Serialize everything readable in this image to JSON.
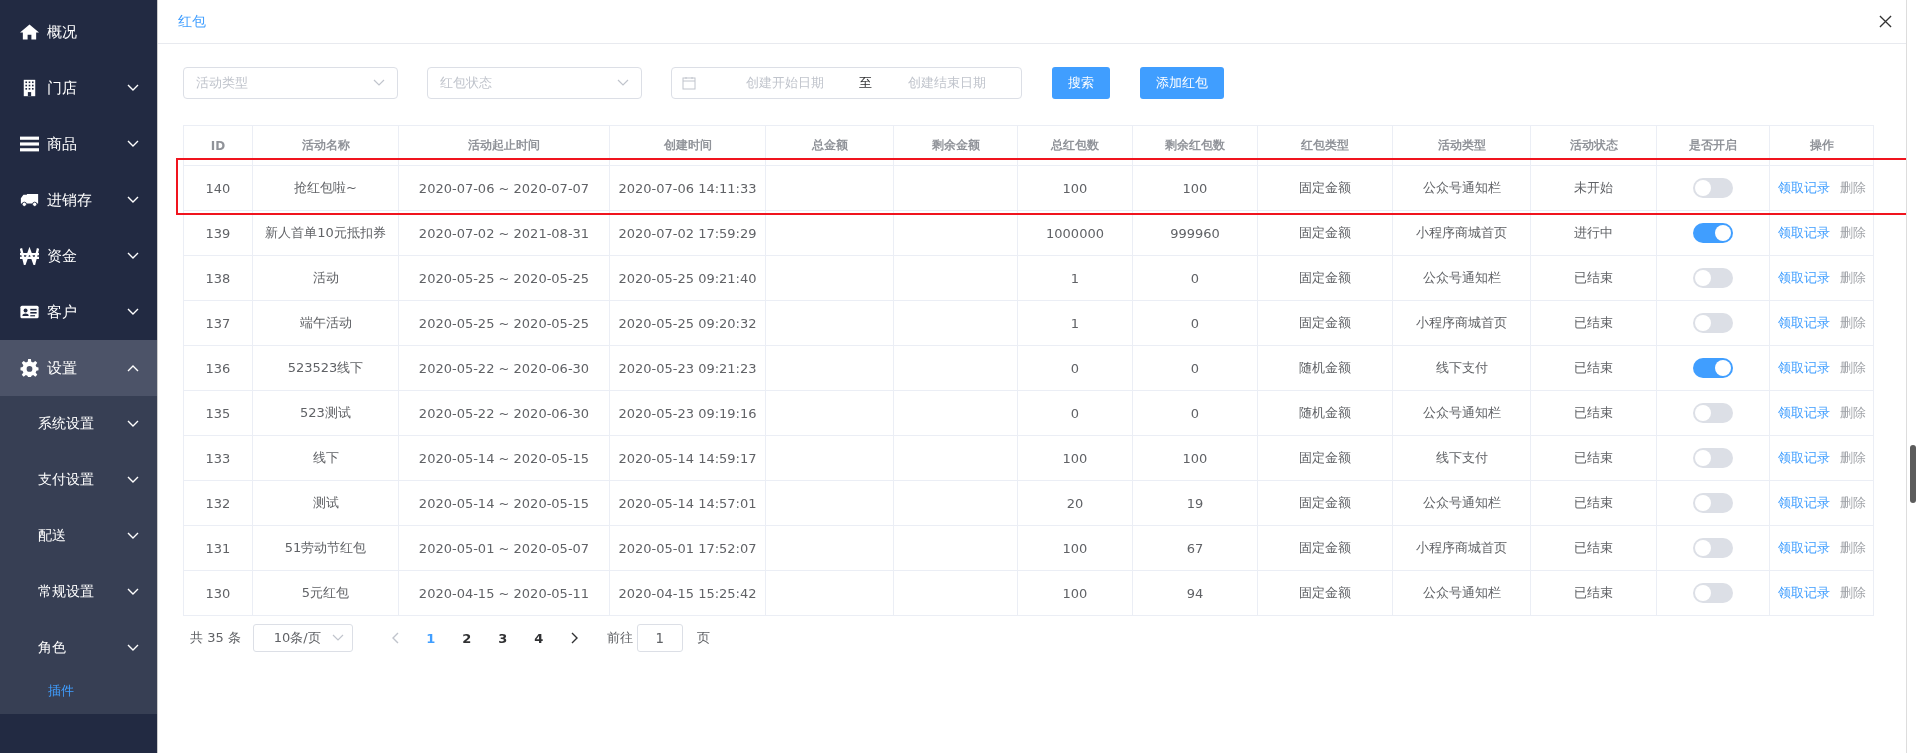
{
  "sidebar": {
    "items": [
      {
        "label": "概况",
        "kind": "link",
        "expanded": false
      },
      {
        "label": "门店",
        "kind": "group",
        "expanded": false
      },
      {
        "label": "商品",
        "kind": "group",
        "expanded": false
      },
      {
        "label": "进销存",
        "kind": "group",
        "expanded": false
      },
      {
        "label": "资金",
        "kind": "group",
        "expanded": false
      },
      {
        "label": "客户",
        "kind": "group",
        "expanded": false
      },
      {
        "label": "设置",
        "kind": "group",
        "expanded": true,
        "children": [
          {
            "label": "系统设置",
            "kind": "group",
            "expanded": false,
            "selected": false
          },
          {
            "label": "支付设置",
            "kind": "group",
            "expanded": false,
            "selected": false
          },
          {
            "label": "配送",
            "kind": "group",
            "expanded": false,
            "selected": false
          },
          {
            "label": "常规设置",
            "kind": "group",
            "expanded": false,
            "selected": false
          },
          {
            "label": "角色",
            "kind": "group",
            "expanded": false,
            "selected": false
          },
          {
            "label": "插件",
            "kind": "link",
            "selected": true
          }
        ]
      }
    ]
  },
  "dialog": {
    "title": "红包",
    "filters": {
      "activity_type": {
        "placeholder": "活动类型"
      },
      "status": {
        "placeholder": "红包状态"
      },
      "start_date": {
        "placeholder": "创建开始日期"
      },
      "separator": "至",
      "end_date": {
        "placeholder": "创建结束日期"
      },
      "buttons": [
        "搜索",
        "添加红包"
      ]
    },
    "table": {
      "columns": [
        "ID",
        "活动名称",
        "活动起止时间",
        "创建时间",
        "总金额",
        "剩余金额",
        "总红包数",
        "剩余红包数",
        "红包类型",
        "活动类型",
        "活动状态",
        "是否开启",
        "操作"
      ],
      "rows": [
        {
          "cells": [
            "140",
            "抢红包啦~",
            "2020-07-06 ~ 2020-07-07",
            "2020-07-06 14:11:33",
            "",
            "",
            "100",
            "100",
            "固定金额",
            "公众号通知栏",
            "未开始"
          ],
          "on": false,
          "actions": [
            "领取记录",
            "删除"
          ]
        },
        {
          "cells": [
            "139",
            "新人首单10元抵扣券",
            "2020-07-02 ~ 2021-08-31",
            "2020-07-02 17:59:29",
            "",
            "",
            "1000000",
            "999960",
            "固定金额",
            "小程序商城首页",
            "进行中"
          ],
          "on": true,
          "actions": [
            "领取记录",
            "删除"
          ]
        },
        {
          "cells": [
            "138",
            "活动",
            "2020-05-25 ~ 2020-05-25",
            "2020-05-25 09:21:40",
            "",
            "",
            "1",
            "0",
            "固定金额",
            "公众号通知栏",
            "已结束"
          ],
          "on": false,
          "actions": [
            "领取记录",
            "删除"
          ]
        },
        {
          "cells": [
            "137",
            "端午活动",
            "2020-05-25 ~ 2020-05-25",
            "2020-05-25 09:20:32",
            "",
            "",
            "1",
            "0",
            "固定金额",
            "小程序商城首页",
            "已结束"
          ],
          "on": false,
          "actions": [
            "领取记录",
            "删除"
          ]
        },
        {
          "cells": [
            "136",
            "523523线下",
            "2020-05-22 ~ 2020-06-30",
            "2020-05-23 09:21:23",
            "",
            "",
            "0",
            "0",
            "随机金额",
            "线下支付",
            "已结束"
          ],
          "on": true,
          "actions": [
            "领取记录",
            "删除"
          ]
        },
        {
          "cells": [
            "135",
            "523测试",
            "2020-05-22 ~ 2020-06-30",
            "2020-05-23 09:19:16",
            "",
            "",
            "0",
            "0",
            "随机金额",
            "公众号通知栏",
            "已结束"
          ],
          "on": false,
          "actions": [
            "领取记录",
            "删除"
          ]
        },
        {
          "cells": [
            "133",
            "线下",
            "2020-05-14 ~ 2020-05-15",
            "2020-05-14 14:59:17",
            "",
            "",
            "100",
            "100",
            "固定金额",
            "线下支付",
            "已结束"
          ],
          "on": false,
          "actions": [
            "领取记录",
            "删除"
          ]
        },
        {
          "cells": [
            "132",
            "测试",
            "2020-05-14 ~ 2020-05-15",
            "2020-05-14 14:57:01",
            "",
            "",
            "20",
            "19",
            "固定金额",
            "公众号通知栏",
            "已结束"
          ],
          "on": false,
          "actions": [
            "领取记录",
            "删除"
          ]
        },
        {
          "cells": [
            "131",
            "51劳动节红包",
            "2020-05-01 ~ 2020-05-07",
            "2020-05-01 17:52:07",
            "",
            "",
            "100",
            "67",
            "固定金额",
            "小程序商城首页",
            "已结束"
          ],
          "on": false,
          "actions": [
            "领取记录",
            "删除"
          ]
        },
        {
          "cells": [
            "130",
            "5元红包",
            "2020-04-15 ~ 2020-05-11",
            "2020-04-15 15:25:42",
            "",
            "",
            "100",
            "94",
            "固定金额",
            "公众号通知栏",
            "已结束"
          ],
          "on": false,
          "actions": [
            "领取记录",
            "删除"
          ]
        }
      ]
    },
    "pagination": {
      "total": "共 35 条",
      "page_size": "10条/页",
      "pages": [
        {
          "label": "1",
          "selected": true
        },
        {
          "label": "2",
          "selected": false
        },
        {
          "label": "3",
          "selected": false
        },
        {
          "label": "4",
          "selected": false
        }
      ],
      "goto_label": "前往",
      "goto_value": "1",
      "page_suffix": "页"
    }
  }
}
